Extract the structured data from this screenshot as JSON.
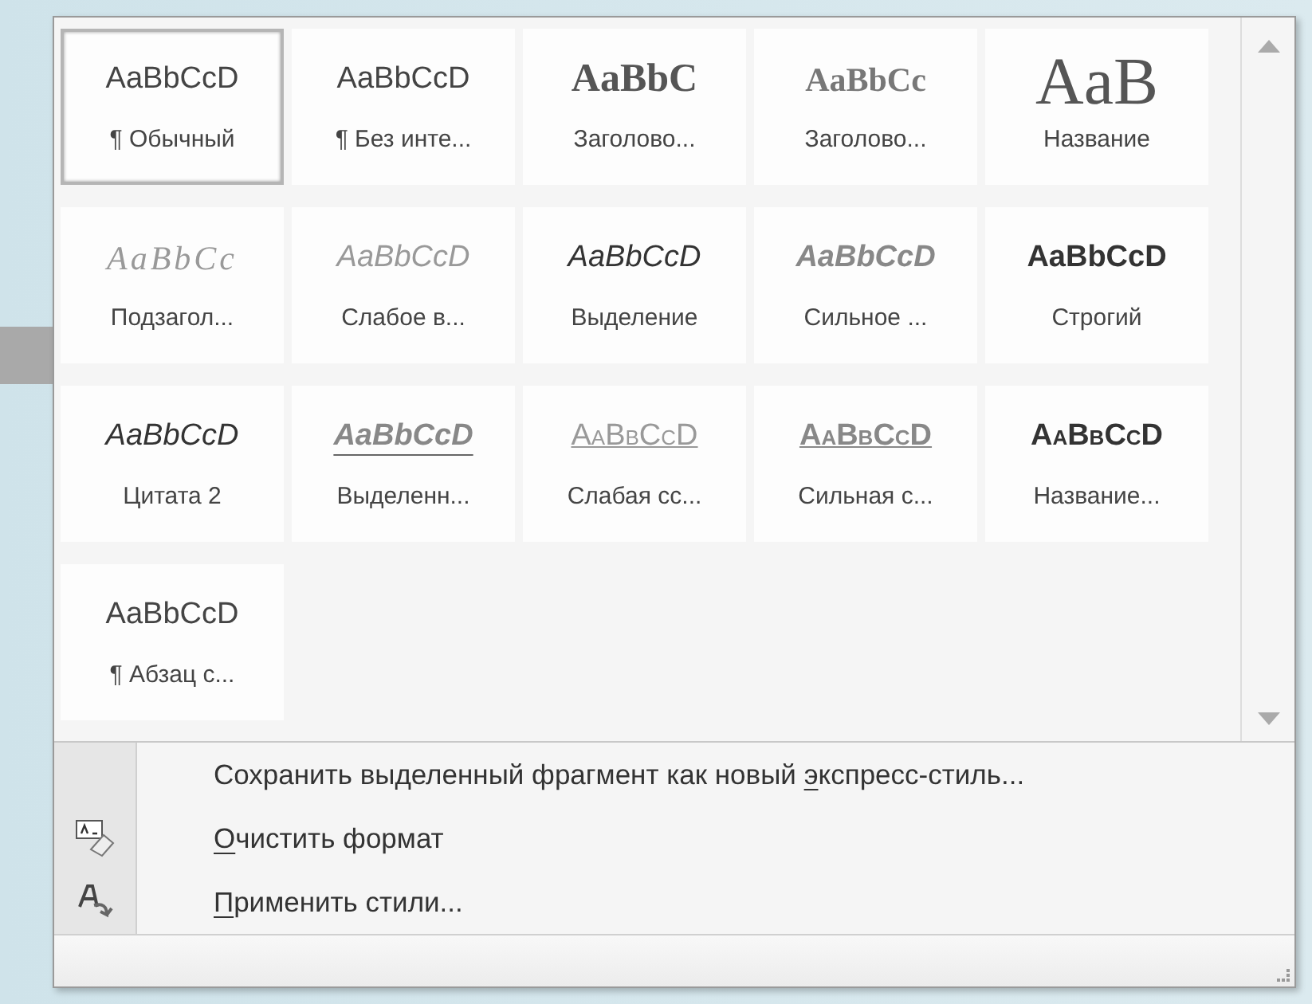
{
  "gallery": {
    "styles": [
      {
        "sample": "AaBbCcD",
        "label": "¶ Обычный",
        "kind": "normal",
        "selected": true
      },
      {
        "sample": "AaBbCcD",
        "label": "¶ Без инте...",
        "kind": "normal",
        "selected": false
      },
      {
        "sample": "AaBbC",
        "label": "Заголово...",
        "kind": "heading1",
        "selected": false
      },
      {
        "sample": "AaBbCc",
        "label": "Заголово...",
        "kind": "heading2",
        "selected": false
      },
      {
        "sample": "AaB",
        "label": "Название",
        "kind": "title",
        "selected": false
      },
      {
        "sample": "AaBbCc",
        "label": "Подзагол...",
        "kind": "subtitle",
        "selected": false
      },
      {
        "sample": "AaBbCcD",
        "label": "Слабое в...",
        "kind": "subtle-emphasis",
        "selected": false
      },
      {
        "sample": "AaBbCcD",
        "label": "Выделение",
        "kind": "emphasis",
        "selected": false
      },
      {
        "sample": "AaBbCcD",
        "label": "Сильное ...",
        "kind": "intense-emphasis",
        "selected": false
      },
      {
        "sample": "AaBbCcD",
        "label": "Строгий",
        "kind": "strong",
        "selected": false
      },
      {
        "sample": "AaBbCcD",
        "label": "Цитата 2",
        "kind": "quote",
        "selected": false
      },
      {
        "sample": "AaBbCcD",
        "label": "Выделенн...",
        "kind": "intense-quote",
        "selected": false
      },
      {
        "sample": "AaBbCcD",
        "label": "Слабая сс...",
        "kind": "subtle-reference",
        "selected": false
      },
      {
        "sample": "AaBbCcD",
        "label": "Сильная с...",
        "kind": "intense-reference",
        "selected": false
      },
      {
        "sample": "AaBbCcD",
        "label": "Название...",
        "kind": "book-title",
        "selected": false
      },
      {
        "sample": "AaBbCcD",
        "label": "¶ Абзац с...",
        "kind": "normal",
        "selected": false
      }
    ]
  },
  "menu": [
    {
      "before": "Сохранить выделенный фрагмент как новый ",
      "access_key": "э",
      "after": "кспресс-стиль..."
    },
    {
      "access_key": "О",
      "after": "чистить формат",
      "kind": "clear-format"
    },
    {
      "access_key": "П",
      "after": "рименить стили...",
      "kind": "apply-styles"
    }
  ]
}
